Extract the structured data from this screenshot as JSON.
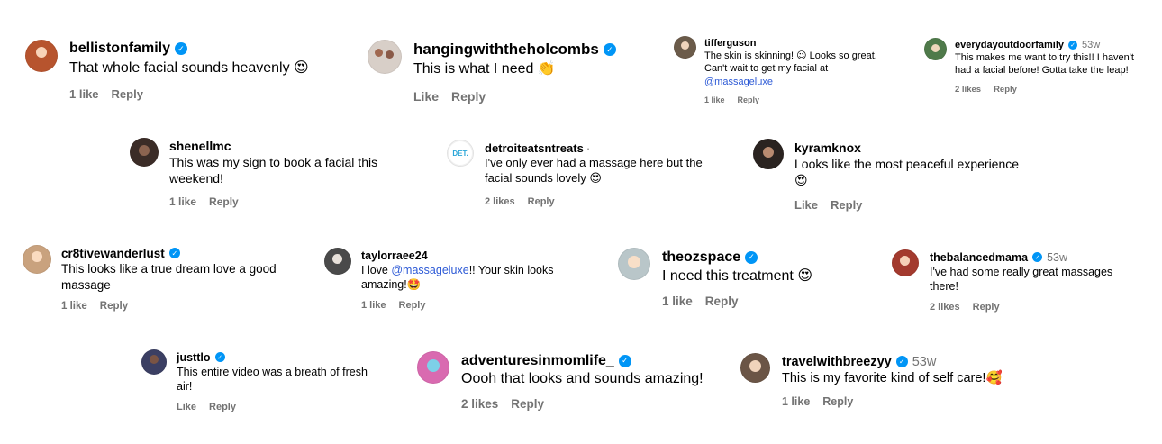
{
  "comments": [
    {
      "username": "bellistonfamily",
      "verified": true,
      "age": "",
      "text": "That whole facial sounds heavenly",
      "emoji": "😍",
      "mention": "",
      "text_after": "",
      "likes": "1 like",
      "reply": "Reply",
      "avatar_color": "#b7542e"
    },
    {
      "username": "hangingwiththeholcombs",
      "verified": true,
      "age": "",
      "text": "This is what I need",
      "emoji": "👏",
      "mention": "",
      "text_after": "",
      "likes": "Like",
      "reply": "Reply",
      "avatar_color": "#d8cfc8"
    },
    {
      "username": "tifferguson",
      "verified": false,
      "age": "",
      "text": "The skin is skinning! 😉 Looks so great. Can't wait to get my facial at ",
      "emoji": "",
      "mention": "@massageluxe",
      "text_after": "",
      "likes": "1 like",
      "reply": "Reply",
      "avatar_color": "#6b5b4a"
    },
    {
      "username": "everydayoutdoorfamily",
      "verified": true,
      "age": "53w",
      "text": "This makes me want to try this!! I haven't had a facial before! Gotta take the leap!",
      "emoji": "",
      "mention": "",
      "text_after": "",
      "likes": "2 likes",
      "reply": "Reply",
      "avatar_color": "#4f7a4a"
    },
    {
      "username": "shenellmc",
      "verified": false,
      "age": "",
      "text": "This was my sign to book a facial this weekend!",
      "emoji": "",
      "mention": "",
      "text_after": "",
      "likes": "1 like",
      "reply": "Reply",
      "avatar_color": "#3b2c27"
    },
    {
      "username": "detroiteatsntreats",
      "verified": false,
      "age": "·",
      "text": "I've only ever had a massage here but the facial sounds lovely",
      "emoji": "😍",
      "mention": "",
      "text_after": "",
      "likes": "2 likes",
      "reply": "Reply",
      "avatar_color": "#ffffff",
      "avatar_text": "DET."
    },
    {
      "username": "kyramknox",
      "verified": false,
      "age": "",
      "text": "Looks like the most peaceful experience",
      "emoji": "😍",
      "mention": "",
      "text_after": "",
      "likes": "Like",
      "reply": "Reply",
      "avatar_color": "#2a2320"
    },
    {
      "username": "cr8tivewanderlust",
      "verified": true,
      "age": "",
      "text": "This looks like a true dream love a good massage",
      "emoji": "",
      "mention": "",
      "text_after": "",
      "likes": "1 like",
      "reply": "Reply",
      "avatar_color": "#c9a27e"
    },
    {
      "username": "taylorraee24",
      "verified": false,
      "age": "",
      "text": "I love ",
      "emoji": "🤩",
      "mention": "@massageluxe",
      "text_after": "!! Your skin looks amazing!",
      "likes": "1 like",
      "reply": "Reply",
      "avatar_color": "#4a4a4a"
    },
    {
      "username": "theozspace",
      "verified": true,
      "age": "",
      "text": "I need this treatment",
      "emoji": "😍",
      "mention": "",
      "text_after": "",
      "likes": "1 like",
      "reply": "Reply",
      "avatar_color": "#b9c6c9"
    },
    {
      "username": "thebalancedmama",
      "verified": true,
      "age": "53w",
      "text": "I've had some really great massages there!",
      "emoji": "",
      "mention": "",
      "text_after": "",
      "likes": "2 likes",
      "reply": "Reply",
      "avatar_color": "#a33a2e"
    },
    {
      "username": "justtlo",
      "verified": true,
      "age": "",
      "text": "This entire video was a breath of fresh air!",
      "emoji": "",
      "mention": "",
      "text_after": "",
      "likes": "Like",
      "reply": "Reply",
      "avatar_color": "#3b3f63"
    },
    {
      "username": "adventuresinmomlife_",
      "verified": true,
      "age": "",
      "text": "Oooh that looks and sounds amazing!",
      "emoji": "",
      "mention": "",
      "text_after": "",
      "likes": "2 likes",
      "reply": "Reply",
      "avatar_color": "#d96ab0"
    },
    {
      "username": "travelwithbreezyy",
      "verified": true,
      "age": "53w",
      "text": "This is my favorite kind of self care!",
      "emoji": "🥰",
      "mention": "",
      "text_after": "",
      "likes": "1 like",
      "reply": "Reply",
      "avatar_color": "#6b5546"
    }
  ],
  "icons": {
    "verified": "checkmark-icon"
  }
}
